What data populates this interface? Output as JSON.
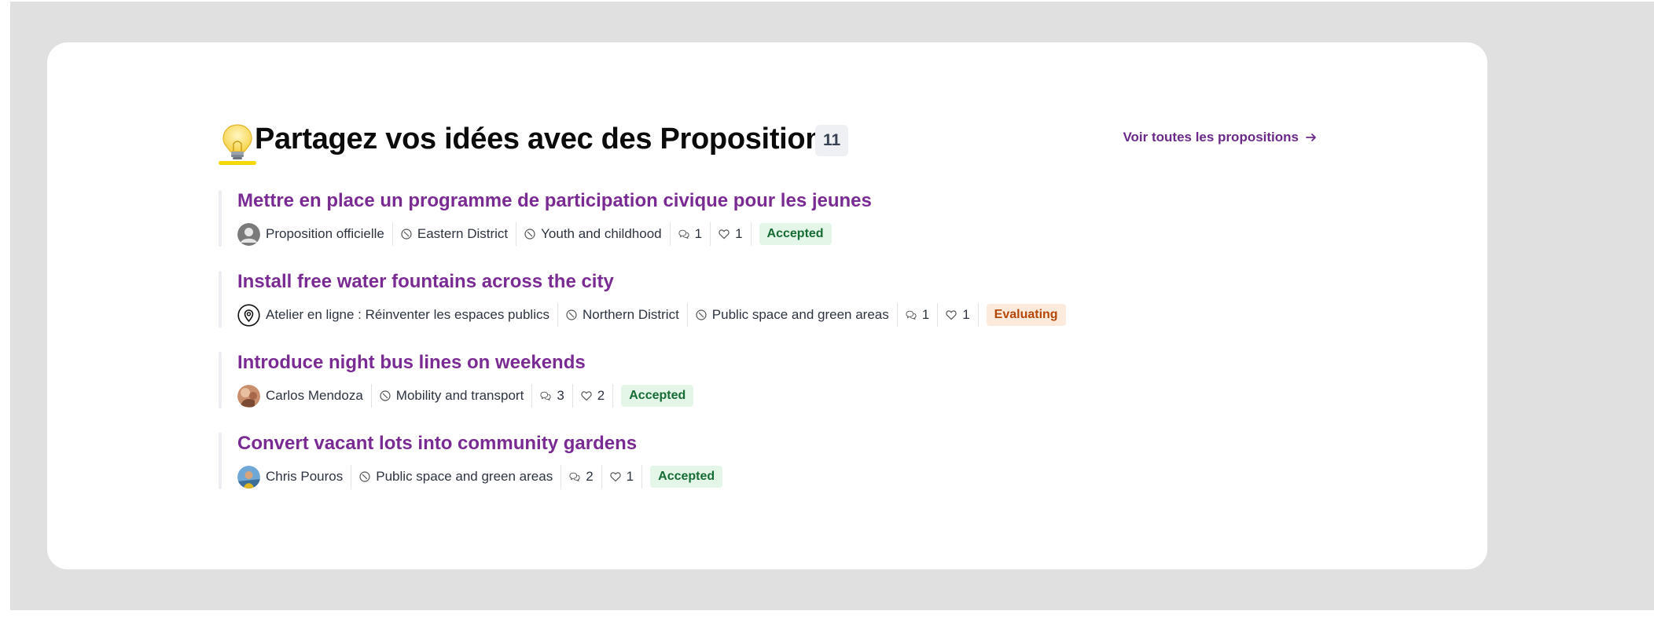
{
  "header": {
    "title": "Partagez vos idées avec des Propositions",
    "count": "11",
    "see_all": "Voir toutes les propositions",
    "icon": "lightbulb-icon"
  },
  "proposals": [
    {
      "title": "Mettre en place un programme de participation civique pour les jeunes",
      "author": "Proposition officielle",
      "author_icon": "default-avatar",
      "scope": "Eastern District",
      "category": "Youth and childhood",
      "comments": "1",
      "likes": "1",
      "status": "Accepted",
      "status_color": "#176b34"
    },
    {
      "title": "Install free water fountains across the city",
      "author": "Atelier en ligne : Réinventer les espaces publics",
      "author_icon": "map-pin-icon",
      "scope": "Northern District",
      "category": "Public space and green areas",
      "comments": "1",
      "likes": "1",
      "status": "Evaluating",
      "status_color": "#b54708"
    },
    {
      "title": "Introduce night bus lines on weekends",
      "author": "Carlos Mendoza",
      "author_icon": "user-photo",
      "category": "Mobility and transport",
      "comments": "3",
      "likes": "2",
      "status": "Accepted",
      "status_color": "#176b34"
    },
    {
      "title": "Convert vacant lots into community gardens",
      "author": "Chris Pouros",
      "author_icon": "user-photo",
      "category": "Public space and green areas",
      "comments": "2",
      "likes": "1",
      "status": "Accepted",
      "status_color": "#176b34"
    }
  ],
  "colors": {
    "accent": "#7a2b93",
    "highlight": "#f5d90a",
    "backdrop": "#e0e0e0"
  }
}
